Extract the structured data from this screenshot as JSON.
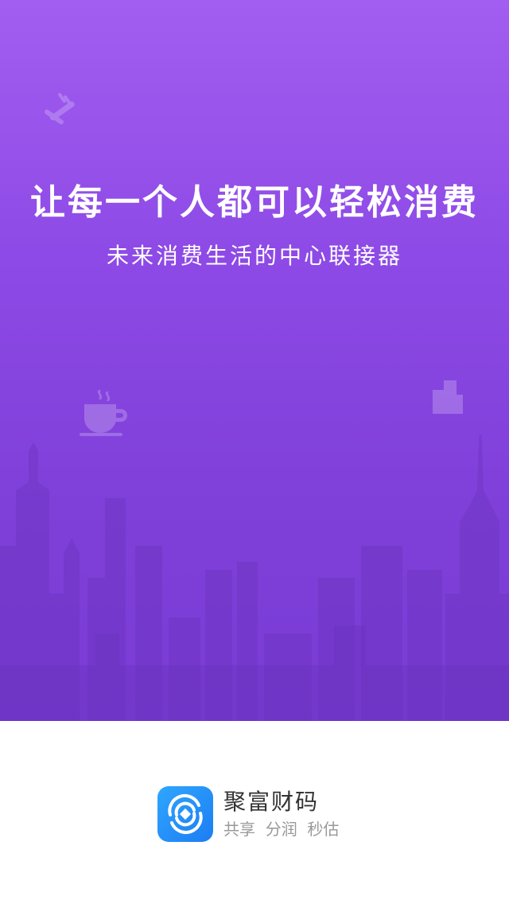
{
  "splash": {
    "headline": "让每一个人都可以轻松消费",
    "subline": "未来消费生活的中心联接器",
    "colors": {
      "gradient_top": "#a25ef0",
      "gradient_bottom": "#7a3cd6",
      "text": "#ffffff"
    }
  },
  "brand": {
    "app_name": "聚富财码",
    "tagline": "共享  分润  秒估",
    "icon": "coin-swirl-icon",
    "colors": {
      "logo": "#1d7df2",
      "name": "#333333",
      "tagline": "#999999"
    }
  }
}
